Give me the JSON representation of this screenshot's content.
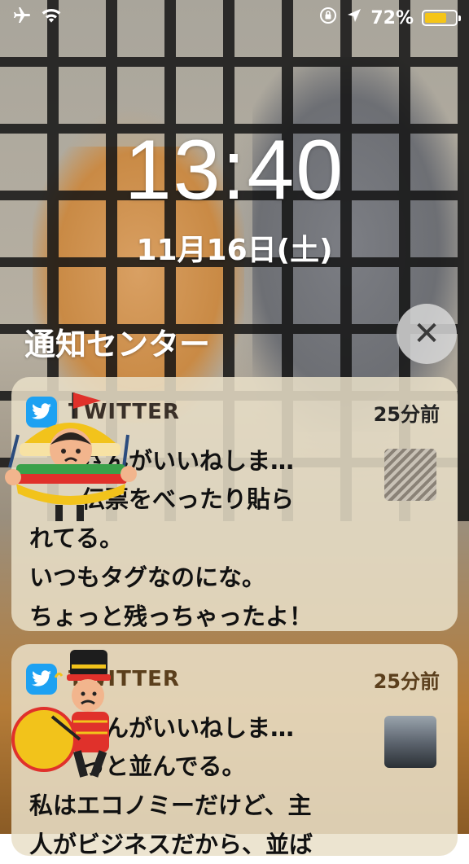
{
  "status_bar": {
    "airplane_icon": "airplane-icon",
    "wifi_icon": "wifi-icon",
    "orientation_lock_icon": "orientation-lock-icon",
    "location_icon": "location-arrow-icon",
    "battery_text": "72%",
    "battery_level": 0.72,
    "battery_color": "#f5c518"
  },
  "lock_screen": {
    "time": "13:40",
    "date": "11月16日(土)"
  },
  "notification_center": {
    "title": "通知センター",
    "close_label": "✕"
  },
  "notifications": [
    {
      "app_name": "TWITTER",
      "time_ago": "25分前",
      "title": "さんがいいねしま…",
      "body_lines": [
        "伝票をべったり貼ら",
        "れてる。",
        "いつもタグなのにな。",
        "ちょっと残っちゃったよ！"
      ]
    },
    {
      "app_name": "TWITTER",
      "time_ago": "25分前",
      "title": "さんがいいねしま…",
      "body_lines": [
        "っと並んでる。",
        "私はエコノミーだけど、主",
        "人がビジネスだから、並ば"
      ]
    }
  ],
  "colors": {
    "twitter_blue": "#1da1f2",
    "card_background": "#e9e0c8"
  }
}
